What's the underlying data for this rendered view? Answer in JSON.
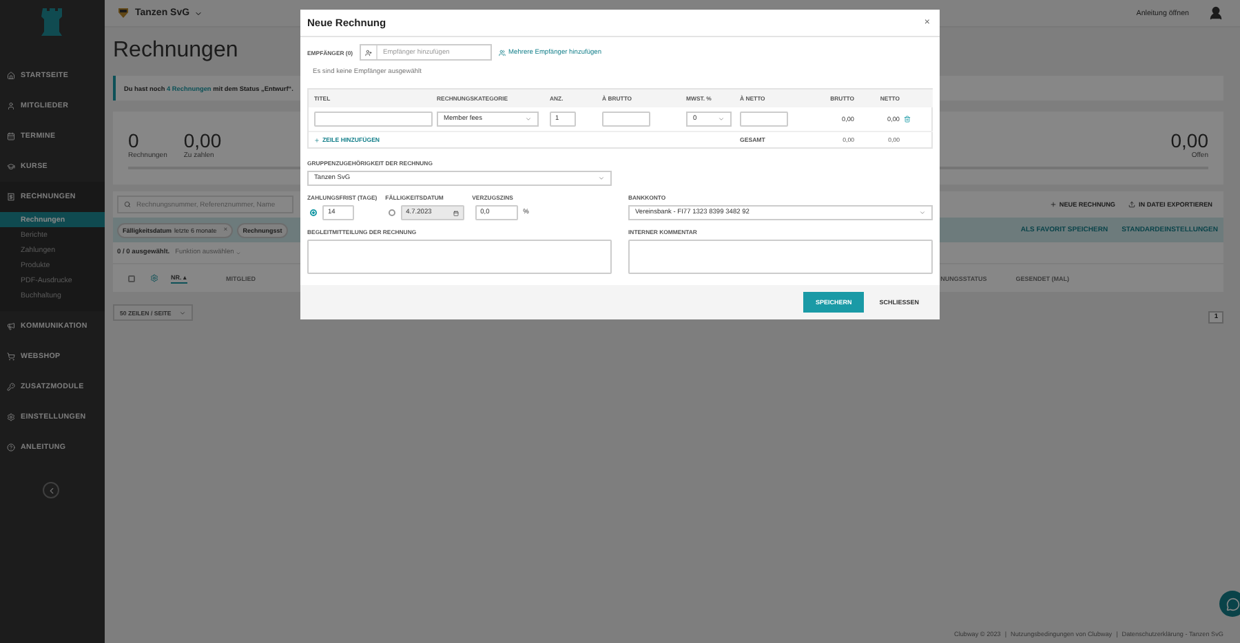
{
  "sidebar": {
    "items": [
      {
        "label": "STARTSEITE",
        "expanded": false
      },
      {
        "label": "MITGLIEDER",
        "expanded": false
      },
      {
        "label": "TERMINE",
        "expanded": false
      },
      {
        "label": "KURSE",
        "expanded": false
      },
      {
        "label": "RECHNUNGEN",
        "expanded": true,
        "children": [
          {
            "label": "Rechnungen",
            "selected": true
          },
          {
            "label": "Berichte",
            "selected": false
          },
          {
            "label": "Zahlungen",
            "selected": false
          },
          {
            "label": "Produkte",
            "selected": false
          },
          {
            "label": "PDF-Ausdrucke",
            "selected": false
          },
          {
            "label": "Buchhaltung",
            "selected": false
          }
        ]
      },
      {
        "label": "KOMMUNIKATION",
        "expanded": false
      },
      {
        "label": "WEBSHOP",
        "expanded": false
      },
      {
        "label": "ZUSATZMODULE",
        "expanded": false
      },
      {
        "label": "EINSTELLUNGEN",
        "expanded": false
      },
      {
        "label": "ANLEITUNG",
        "expanded": false
      }
    ]
  },
  "header": {
    "organization": "Tanzen SvG",
    "help_link": "Anleitung öffnen"
  },
  "page_title": "Rechnungen",
  "alert": {
    "before": "Du hast noch ",
    "link": "4 Rechnungen",
    "after": " mit dem Status „Entwurf“."
  },
  "stats": [
    {
      "value": "0",
      "label": "Rechnungen"
    },
    {
      "value": "0,00",
      "label": "Zu zahlen"
    }
  ],
  "stats_right": {
    "value": "0,00",
    "label": "Offen"
  },
  "search": {
    "placeholder": "Rechnungsnummer, Referenznummer, Name"
  },
  "actions": [
    "NEUE RECHNUNG",
    "IN DATEI EXPORTIEREN"
  ],
  "filters": {
    "chips": [
      {
        "field": "Fälligkeitsdatum",
        "value": "letzte 6 monate",
        "remove": "×"
      },
      {
        "field": "Rechnungsst"
      }
    ],
    "actions": [
      "ALS FAVORIT SPEICHERN",
      "STANDARDEINSTELLUNGEN"
    ]
  },
  "selection": {
    "count": "0 / 0 ausgewählt.",
    "function": "Funktion auswählen"
  },
  "table": {
    "select_all": {
      "checked": false
    },
    "columns_left": [
      {
        "label": "NR.",
        "sorted": true,
        "sort_mark": "▴"
      },
      {
        "label": "MITGLIED",
        "sorted": false
      }
    ],
    "columns_right": [
      {
        "label": "NUNGSSTATUS",
        "sorted": false
      },
      {
        "label": "GESENDET (MAL)",
        "sorted": false
      }
    ]
  },
  "rows_per_page": "50 ZEILEN / SEITE",
  "pagination": [
    {
      "label": "1",
      "selected": true
    }
  ],
  "footer": {
    "items": [
      "Clubway © 2023",
      "Nutzungsbedingungen von Clubway",
      "Datenschutzerklärung - Tanzen SvG"
    ],
    "separator": "|"
  },
  "modal": {
    "title": "Neue Rechnung",
    "close": "×",
    "recipients": {
      "label": "EMPFÄNGER (0)",
      "placeholder": "Empfänger hinzufügen",
      "link": "Mehrere Empfänger hinzufügen",
      "empty_note": "Es sind keine Empfänger ausgewählt"
    },
    "items_table": {
      "columns": [
        "TITEL",
        "RECHNUNGSKATEGORIE",
        "ANZ.",
        "À BRUTTO",
        "MWST. %",
        "À NETTO",
        "BRUTTO",
        "NETTO"
      ],
      "rows": [
        {
          "title": "",
          "category": "Member fees",
          "quantity": "1",
          "unit_gross": "",
          "vat": "0",
          "unit_net": "",
          "gross": "0,00",
          "net": "0,00"
        }
      ],
      "add_row": "ZEILE HINZUFÜGEN",
      "total_label": "GESAMT",
      "total_gross": "0,00",
      "total_net": "0,00"
    },
    "group": {
      "label": "GRUPPENZUGEHÖRIGKEIT DER RECHNUNG",
      "value": "Tanzen SvG"
    },
    "payment_term": {
      "label": "ZAHLUNGSFRIST (TAGE)",
      "value": "14",
      "selected": true
    },
    "due_date": {
      "label": "FÄLLIGKEITSDATUM",
      "value": "4.7.2023",
      "selected": false,
      "disabled": true
    },
    "interest": {
      "label": "VERZUGSZINS",
      "value": "0,0",
      "unit": "%"
    },
    "bank_account": {
      "label": "BANKKONTO",
      "value": "Vereinsbank - FI77 1323 8399 3482 92"
    },
    "message": {
      "label": "BEGLEITMITTEILUNG DER RECHNUNG"
    },
    "comment": {
      "label": "INTERNER KOMMENTAR"
    },
    "buttons": [
      {
        "label": "SPEICHERN",
        "kind": "primary"
      },
      {
        "label": "SCHLIESSEN",
        "kind": "plain"
      }
    ]
  }
}
